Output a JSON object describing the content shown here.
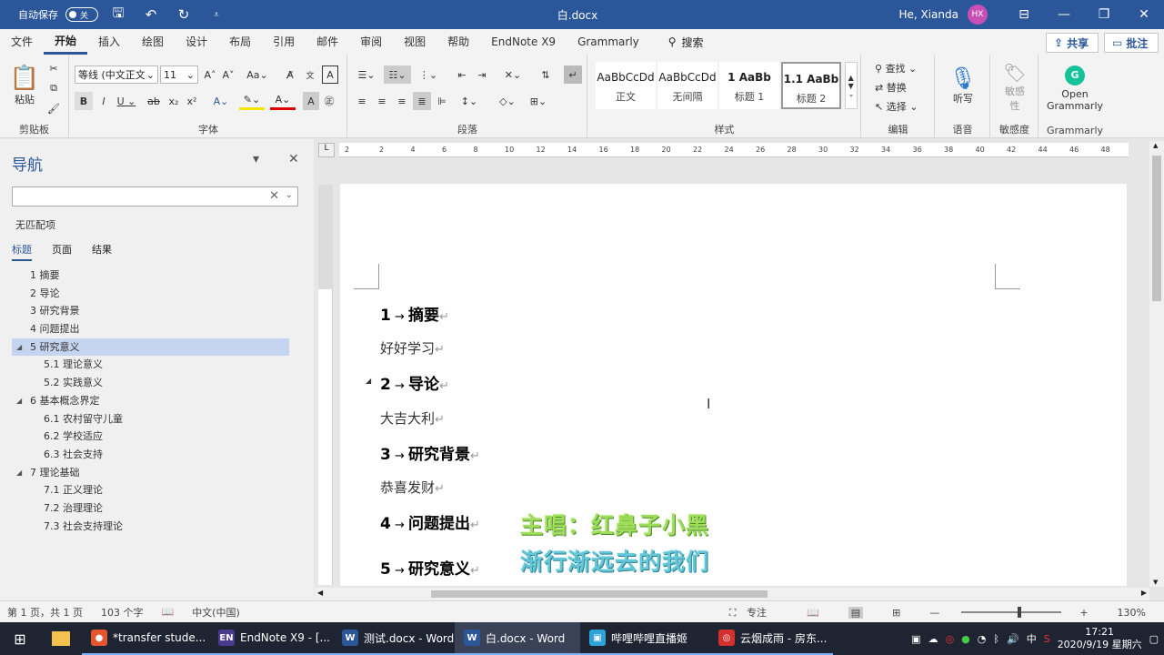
{
  "titlebar": {
    "autosave_label": "自动保存",
    "autosave_state": "关",
    "doc_title": "白.docx",
    "user_name": "He, Xianda",
    "avatar_initials": "HX"
  },
  "tabs": [
    "文件",
    "开始",
    "插入",
    "绘图",
    "设计",
    "布局",
    "引用",
    "邮件",
    "审阅",
    "视图",
    "帮助",
    "EndNote X9",
    "Grammarly"
  ],
  "search_label": "搜索",
  "share_label": "共享",
  "comment_label": "批注",
  "ribbon": {
    "clipboard": {
      "paste": "粘贴",
      "label": "剪贴板"
    },
    "font": {
      "family": "等线 (中文正文",
      "size": "11",
      "label": "字体"
    },
    "paragraph": {
      "label": "段落"
    },
    "styles": {
      "label": "样式",
      "items": [
        {
          "sample": "AaBbCcDd",
          "name": "正文"
        },
        {
          "sample": "AaBbCcDd",
          "name": "无间隔"
        },
        {
          "sample": "1 AaBb",
          "name": "标题 1"
        },
        {
          "sample": "1.1 AaBb",
          "name": "标题 2"
        }
      ]
    },
    "editing": {
      "find": "查找",
      "replace": "替换",
      "select": "选择",
      "label": "编辑"
    },
    "voice": {
      "dictate": "听写",
      "label": "语音"
    },
    "sensitivity": {
      "button": "敏感性",
      "label": "敏感度"
    },
    "grammarly": {
      "button": "Open Grammarly",
      "label": "Grammarly"
    }
  },
  "nav": {
    "title": "导航",
    "no_match": "无匹配项",
    "tabs": [
      "标题",
      "页面",
      "结果"
    ],
    "items": [
      {
        "text": "1 摘要",
        "level": 1,
        "arrow": false,
        "selected": false
      },
      {
        "text": "2 导论",
        "level": 1,
        "arrow": false,
        "selected": false
      },
      {
        "text": "3 研究背景",
        "level": 1,
        "arrow": false,
        "selected": false
      },
      {
        "text": "4 问题提出",
        "level": 1,
        "arrow": false,
        "selected": false
      },
      {
        "text": "5 研究意义",
        "level": 1,
        "arrow": true,
        "selected": true
      },
      {
        "text": "5.1 理论意义",
        "level": 2,
        "arrow": false,
        "selected": false
      },
      {
        "text": "5.2 实践意义",
        "level": 2,
        "arrow": false,
        "selected": false
      },
      {
        "text": "6 基本概念界定",
        "level": 1,
        "arrow": true,
        "selected": false
      },
      {
        "text": "6.1 农村留守儿童",
        "level": 2,
        "arrow": false,
        "selected": false
      },
      {
        "text": "6.2 学校适应",
        "level": 2,
        "arrow": false,
        "selected": false
      },
      {
        "text": "6.3 社会支持",
        "level": 2,
        "arrow": false,
        "selected": false
      },
      {
        "text": "7 理论基础",
        "level": 1,
        "arrow": true,
        "selected": false
      },
      {
        "text": "7.1 正义理论",
        "level": 2,
        "arrow": false,
        "selected": false
      },
      {
        "text": "7.2 治理理论",
        "level": 2,
        "arrow": false,
        "selected": false
      },
      {
        "text": "7.3 社会支持理论",
        "level": 2,
        "arrow": false,
        "selected": false
      }
    ]
  },
  "document": {
    "lines": [
      {
        "kind": "heading",
        "num": "1",
        "text": "摘要"
      },
      {
        "kind": "body",
        "text": "好好学习"
      },
      {
        "kind": "heading",
        "num": "2",
        "text": "导论"
      },
      {
        "kind": "body",
        "text": "大吉大利"
      },
      {
        "kind": "heading",
        "num": "3",
        "text": "研究背景"
      },
      {
        "kind": "body",
        "text": "恭喜发财"
      },
      {
        "kind": "heading",
        "num": "4",
        "text": "问题提出"
      },
      {
        "kind": "heading",
        "num": "5",
        "text": "研究意义"
      }
    ],
    "lyric_line1": "主唱：红鼻子小黑",
    "lyric_line2": "渐行渐远去的我们"
  },
  "ruler_ticks": [
    "2",
    "2",
    "4",
    "6",
    "8",
    "10",
    "12",
    "14",
    "16",
    "18",
    "20",
    "22",
    "24",
    "26",
    "28",
    "30",
    "32",
    "34",
    "36",
    "38",
    "40",
    "42",
    "44",
    "46",
    "48"
  ],
  "statusbar": {
    "page": "第 1 页，共 1 页",
    "words": "103 个字",
    "language": "中文(中国)",
    "focus": "专注",
    "zoom": "130%"
  },
  "taskbar": {
    "apps": [
      {
        "label": "*transfer stude...",
        "icon_color": "#e4572e",
        "icon_text": "●"
      },
      {
        "label": "EndNote X9 - [...",
        "icon_color": "#4b3b8f",
        "icon_text": "EN"
      },
      {
        "label": "测试.docx - Word",
        "icon_color": "#2b579a",
        "icon_text": "W"
      },
      {
        "label": "白.docx - Word",
        "icon_color": "#2b579a",
        "icon_text": "W"
      },
      {
        "label": "哔哩哔哩直播姬",
        "icon_color": "#2ea3d8",
        "icon_text": "▣"
      },
      {
        "label": "云烟成雨 - 房东...",
        "icon_color": "#d4302e",
        "icon_text": "◎"
      }
    ],
    "ime": "中",
    "time": "17:21",
    "date": "2020/9/19 星期六"
  },
  "colors": {
    "word_blue": "#2b579a",
    "taskbar": "#1f2433",
    "nav_selected": "#c5d4f0"
  }
}
